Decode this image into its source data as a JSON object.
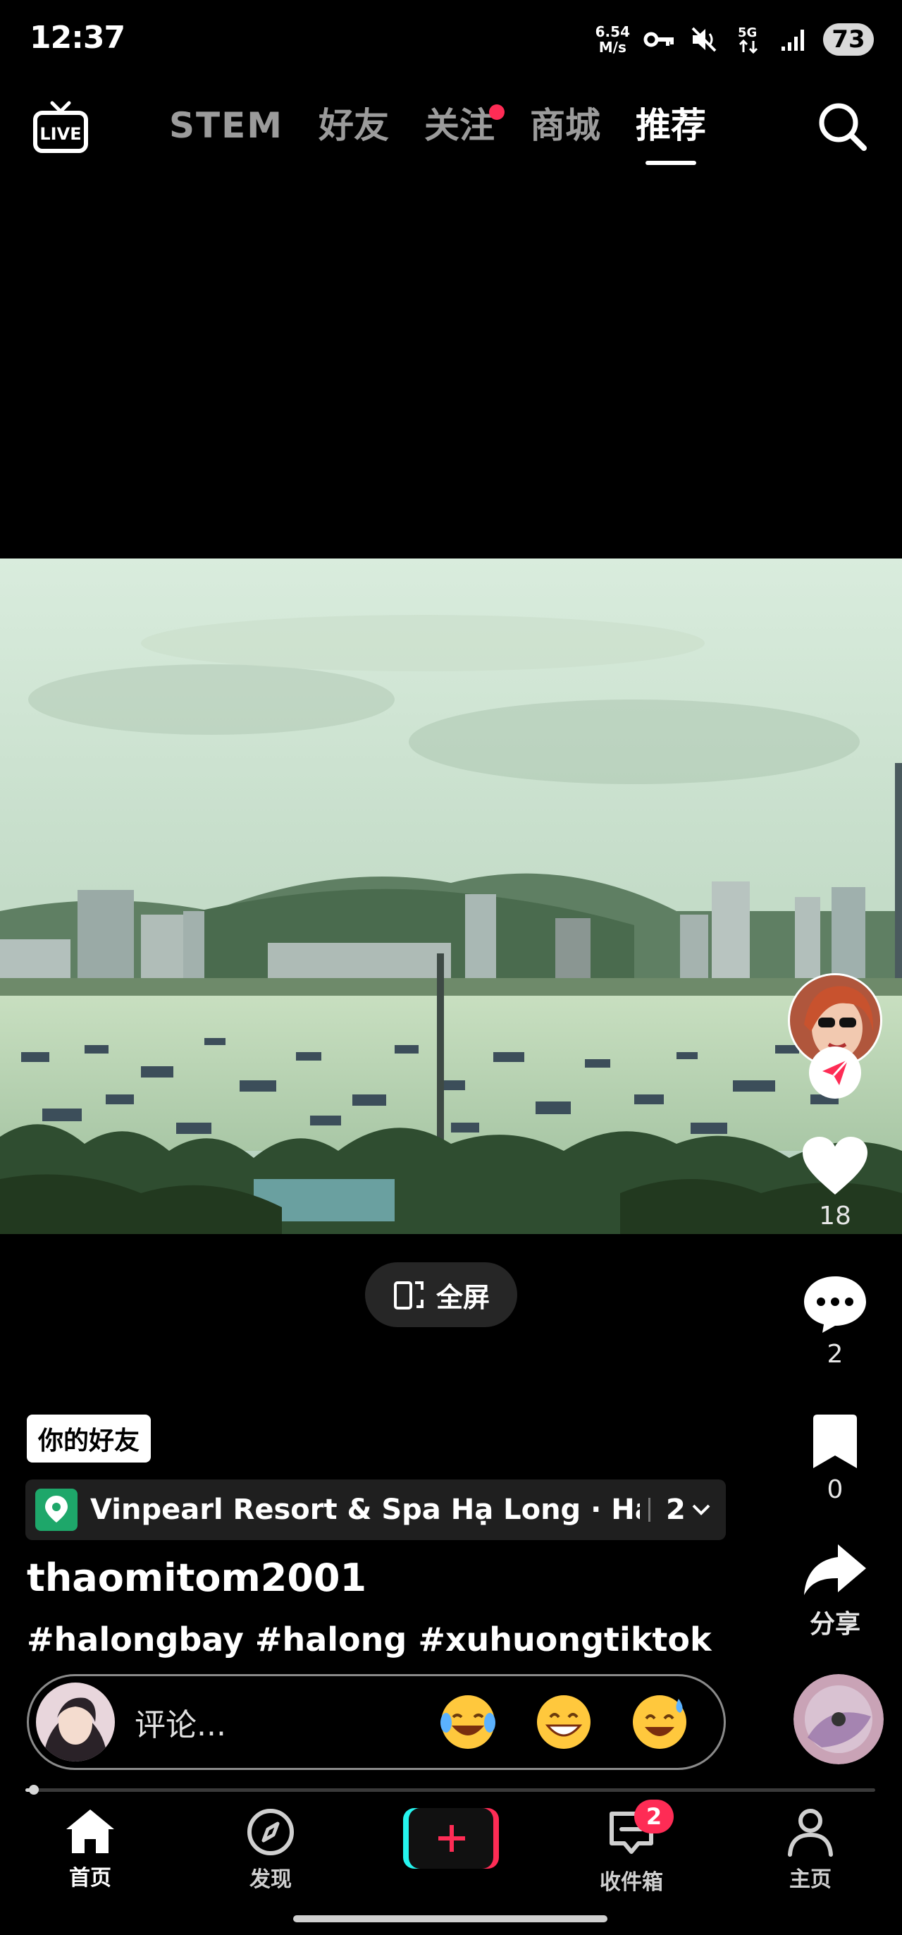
{
  "status_bar": {
    "time": "12:37",
    "net_speed_value": "6.54",
    "net_speed_unit": "M/s",
    "network": "5G",
    "battery": "73",
    "icons": [
      "vpn-key-icon",
      "mute-icon",
      "5g-icon",
      "signal-icon",
      "battery-icon"
    ]
  },
  "top_nav": {
    "live_label": "LIVE",
    "tabs": [
      {
        "label": "STEM",
        "active": false
      },
      {
        "label": "好友",
        "active": false
      },
      {
        "label": "关注",
        "active": false,
        "dot": true
      },
      {
        "label": "商城",
        "active": false
      },
      {
        "label": "推荐",
        "active": true
      }
    ],
    "search_icon": "search-icon"
  },
  "video": {
    "scene": "harbor-with-boats"
  },
  "right_rail": {
    "like_count": "18",
    "comment_count": "2",
    "favorite_count": "0",
    "share_label": "分享"
  },
  "fullscreen": {
    "label": "全屏"
  },
  "caption": {
    "friend_tag": "你的好友",
    "location": "Vinpearl Resort & Spa Hạ Long · Ha ...",
    "location_count": "2",
    "username": "thaomitom2001",
    "hashtags": "#halongbay #halong #xuhuongtiktok"
  },
  "comment_bar": {
    "placeholder": "评论...",
    "emojis": [
      "😂",
      "😁",
      "😅"
    ]
  },
  "progress": {
    "fraction": 0.01
  },
  "bottom_nav": {
    "items": [
      {
        "label": "首页",
        "icon": "home-icon",
        "active": true
      },
      {
        "label": "发现",
        "icon": "compass-icon",
        "active": false
      },
      {
        "label": "",
        "icon": "plus-icon",
        "active": false
      },
      {
        "label": "收件箱",
        "icon": "inbox-icon",
        "active": false,
        "badge": "2"
      },
      {
        "label": "主页",
        "icon": "profile-icon",
        "active": false
      }
    ]
  },
  "colors": {
    "accent": "#fe2c55",
    "location_green": "#1ea76a",
    "create_cyan": "#25f4ee"
  }
}
